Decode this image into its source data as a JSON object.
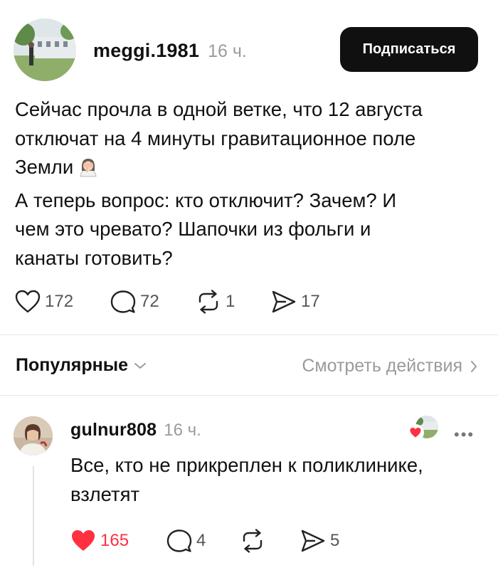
{
  "post": {
    "username": "meggi.1981",
    "timestamp": "16 ч.",
    "follow_label": "Подписаться",
    "text_lines": [
      "Сейчас прочла в одной ветке, что 12 августа",
      "отключат на 4 минуты гравитационное поле",
      "Земли",
      "А теперь вопрос: кто отключит? Зачем? И",
      "чем это чревато? Шапочки из фольги и",
      "канаты готовить?"
    ],
    "emoji_icon": "woman-facepalming-icon",
    "stats": {
      "likes": "172",
      "replies": "72",
      "reposts": "1",
      "shares": "17"
    }
  },
  "sort": {
    "label": "Популярные",
    "view_activity": "Смотреть действия"
  },
  "reply": {
    "username": "gulnur808",
    "timestamp": "16 ч.",
    "text_lines": [
      "Все, кто не прикреплен к поликлинике,",
      "взлетят"
    ],
    "more_label": "•••",
    "stats": {
      "likes": "165",
      "replies": "4",
      "shares": "5"
    },
    "liked": true
  },
  "colors": {
    "like_red": "#ff3040",
    "follow_bg": "#101010",
    "muted_text": "#9b9b9b"
  }
}
